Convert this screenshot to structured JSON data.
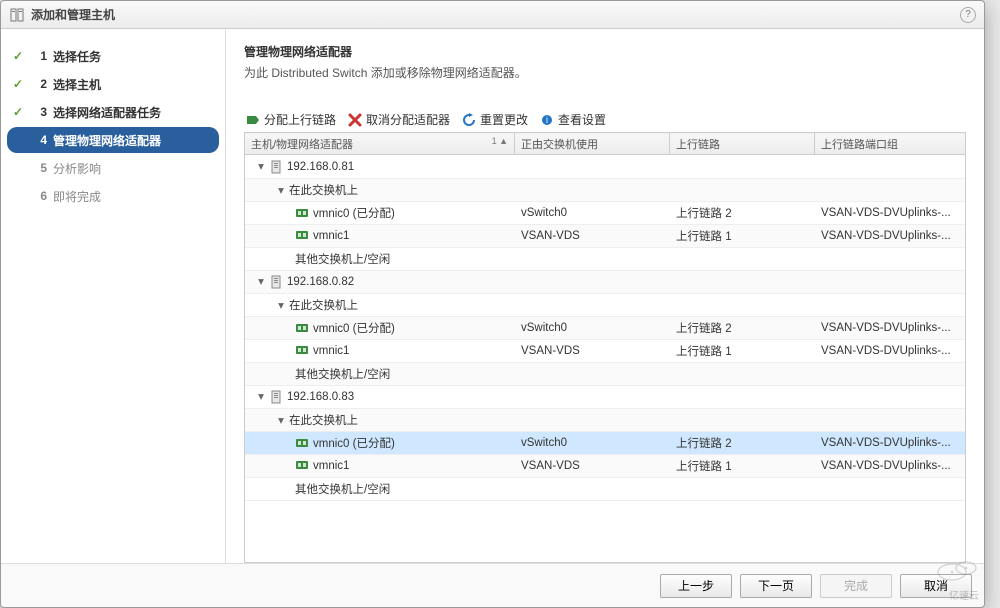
{
  "dialog": {
    "title": "添加和管理主机"
  },
  "sidebar": {
    "steps": [
      {
        "num": "1",
        "label": "选择任务",
        "state": "done"
      },
      {
        "num": "2",
        "label": "选择主机",
        "state": "done"
      },
      {
        "num": "3",
        "label": "选择网络适配器任务",
        "state": "done"
      },
      {
        "num": "4",
        "label": "管理物理网络适配器",
        "state": "current"
      },
      {
        "num": "5",
        "label": "分析影响",
        "state": "future"
      },
      {
        "num": "6",
        "label": "即将完成",
        "state": "future"
      }
    ]
  },
  "main": {
    "heading": "管理物理网络适配器",
    "description": "为此 Distributed Switch 添加或移除物理网络适配器。"
  },
  "toolbar": {
    "assign": {
      "icon": "assign-uplink-icon",
      "label": "分配上行链路"
    },
    "unassign": {
      "icon": "unassign-icon",
      "label": "取消分配适配器"
    },
    "reset": {
      "icon": "reset-icon",
      "label": "重置更改"
    },
    "view": {
      "icon": "view-settings-icon",
      "label": "查看设置"
    }
  },
  "table": {
    "columns": {
      "host": "主机/物理网络适配器",
      "inuse": "正由交换机使用",
      "uplink": "上行链路",
      "port": "上行链路端口组"
    },
    "rows": [
      {
        "kind": "host",
        "indent": 0,
        "name": "192.168.0.81"
      },
      {
        "kind": "group",
        "indent": 1,
        "name": "在此交换机上"
      },
      {
        "kind": "nic",
        "indent": 2,
        "name": "vmnic0 (已分配)",
        "inuse": "vSwitch0",
        "uplink": "上行链路 2",
        "port": "VSAN-VDS-DVUplinks-..."
      },
      {
        "kind": "nic",
        "indent": 2,
        "name": "vmnic1",
        "inuse": "VSAN-VDS",
        "uplink": "上行链路 1",
        "port": "VSAN-VDS-DVUplinks-..."
      },
      {
        "kind": "text",
        "indent": 3,
        "name": "其他交换机上/空闲"
      },
      {
        "kind": "host",
        "indent": 0,
        "name": "192.168.0.82"
      },
      {
        "kind": "group",
        "indent": 1,
        "name": "在此交换机上"
      },
      {
        "kind": "nic",
        "indent": 2,
        "name": "vmnic0 (已分配)",
        "inuse": "vSwitch0",
        "uplink": "上行链路 2",
        "port": "VSAN-VDS-DVUplinks-..."
      },
      {
        "kind": "nic",
        "indent": 2,
        "name": "vmnic1",
        "inuse": "VSAN-VDS",
        "uplink": "上行链路 1",
        "port": "VSAN-VDS-DVUplinks-..."
      },
      {
        "kind": "text",
        "indent": 3,
        "name": "其他交换机上/空闲"
      },
      {
        "kind": "host",
        "indent": 0,
        "name": "192.168.0.83"
      },
      {
        "kind": "group",
        "indent": 1,
        "name": "在此交换机上"
      },
      {
        "kind": "nic",
        "indent": 2,
        "name": "vmnic0 (已分配)",
        "inuse": "vSwitch0",
        "uplink": "上行链路 2",
        "port": "VSAN-VDS-DVUplinks-...",
        "selected": true
      },
      {
        "kind": "nic",
        "indent": 2,
        "name": "vmnic1",
        "inuse": "VSAN-VDS",
        "uplink": "上行链路 1",
        "port": "VSAN-VDS-DVUplinks-..."
      },
      {
        "kind": "text",
        "indent": 3,
        "name": "其他交换机上/空闲"
      }
    ]
  },
  "footer": {
    "back": "上一步",
    "next": "下一页",
    "finish": "完成",
    "cancel": "取消"
  },
  "watermark": "亿速云"
}
